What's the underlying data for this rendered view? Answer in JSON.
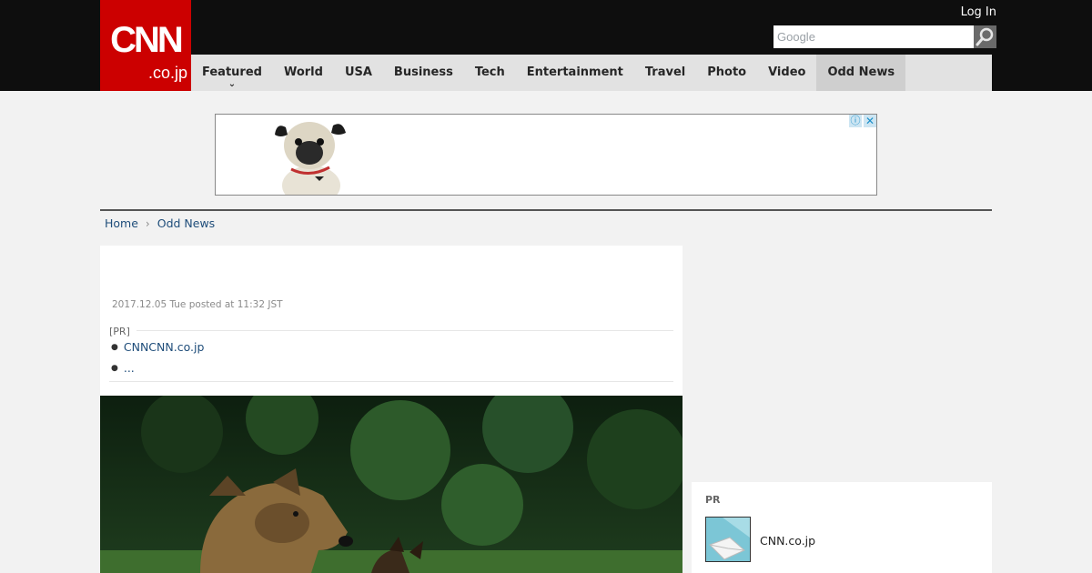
{
  "header": {
    "logo_text": "CNN",
    "logo_subtext": ".co.jp",
    "login_label": "Log In",
    "search": {
      "placeholder": "Google",
      "value": ""
    }
  },
  "nav": {
    "items": [
      {
        "label": "Featured",
        "has_dropdown": true
      },
      {
        "label": "World"
      },
      {
        "label": "USA"
      },
      {
        "label": "Business"
      },
      {
        "label": "Tech"
      },
      {
        "label": "Entertainment"
      },
      {
        "label": "Travel"
      },
      {
        "label": "Photo"
      },
      {
        "label": "Video"
      },
      {
        "label": "Odd News",
        "active": true
      }
    ]
  },
  "breadcrumb": {
    "home": "Home",
    "current": "Odd News"
  },
  "article": {
    "dateline": "2017.12.05 Tue posted at 11:32 JST",
    "pr_tag": "[PR]",
    "pr_links": [
      "CNNCNN.co.jp",
      "..."
    ]
  },
  "sidebar": {
    "pr_title": "PR",
    "pr_item_label": "CNN.co.jp"
  },
  "colors": {
    "header_bg": "#0e0e0e",
    "brand_red": "#cc0000",
    "nav_bg": "#e2e2e2",
    "nav_active_bg": "#cfcfcf",
    "link": "#1f4d7a",
    "page_bg": "#f2f2f2"
  },
  "icons": {
    "search": "magnifier-icon",
    "dropdown": "chevron-down-icon",
    "breadcrumb_sep": "chevron-right-icon",
    "ad_info": "info-icon",
    "ad_close": "close-icon"
  }
}
